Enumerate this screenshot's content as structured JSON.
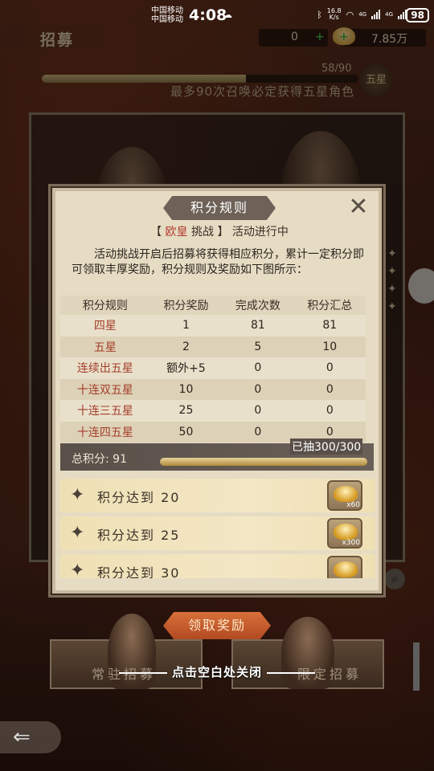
{
  "status_bar": {
    "carrier1": "中国移动",
    "carrier2": "中国移动",
    "time": "4:08",
    "net_speed_value": "16.8",
    "net_speed_unit": "K/s",
    "net_labels": [
      "4G",
      "4G"
    ],
    "battery": "98"
  },
  "top_bar": {
    "title": "招募",
    "currency_1": "0",
    "currency_2": "7.85万"
  },
  "progress": {
    "text": "58/90",
    "fraction": 0.644,
    "note": "最多90次召唤必定获得五星角色",
    "badge": "五星"
  },
  "modal": {
    "title": "积分规则",
    "subtitle_open": "【",
    "subtitle_name": "欧皇",
    "subtitle_mid": "挑战",
    "subtitle_close": "】",
    "subtitle_status": "活动进行中",
    "description": "活动挑战开启后招募将获得相应积分，累计一定积分即可领取丰厚奖励，积分规则及奖励如下图所示：",
    "table": {
      "headers": [
        "积分规则",
        "积分奖励",
        "完成次数",
        "积分汇总"
      ],
      "rows": [
        [
          "四星",
          "1",
          "81",
          "81"
        ],
        [
          "五星",
          "2",
          "5",
          "10"
        ],
        [
          "连续出五星",
          "额外+5",
          "0",
          "0"
        ],
        [
          "十连双五星",
          "10",
          "0",
          "0"
        ],
        [
          "十连三五星",
          "25",
          "0",
          "0"
        ],
        [
          "十连四五星",
          "50",
          "0",
          "0"
        ]
      ]
    },
    "total_label": "总积分: 91",
    "drawn_label": "已抽300/300",
    "drawn_fraction": 1.0,
    "rewards": [
      {
        "label": "积分达到",
        "value": "20",
        "qty": "x60"
      },
      {
        "label": "积分达到",
        "value": "25",
        "qty": "x300"
      },
      {
        "label": "积分达到",
        "value": "30",
        "qty": ""
      }
    ]
  },
  "bottom": {
    "claim_button": "领取奖励",
    "close_hint": "点击空白处关闭",
    "banner_left": "常驻招募",
    "banner_right": "限定招募"
  },
  "colors": {
    "accent_red": "#b23a2c",
    "modal_bg": "#e6dcc4",
    "button_orange": "#c85a2c"
  }
}
